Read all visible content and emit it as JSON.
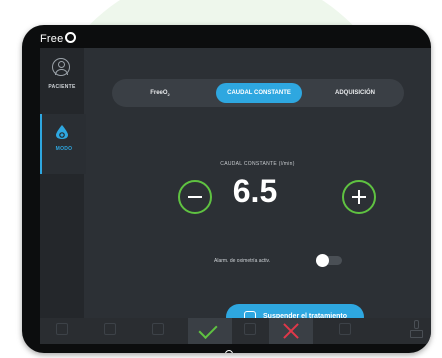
{
  "brand": {
    "name": "Free"
  },
  "sidebar": {
    "items": [
      {
        "label": "PACIENTE",
        "icon": "patient-icon"
      },
      {
        "label": "MODO",
        "icon": "drop-icon"
      }
    ]
  },
  "tabs": [
    {
      "label": "FreeO",
      "subscript": "2"
    },
    {
      "label": "CAUDAL CONSTANTE"
    },
    {
      "label": "ADQUISICIÓN"
    }
  ],
  "flow": {
    "label": "CAUDAL CONSTANTE  (l/min)",
    "value": "6.5"
  },
  "alarm": {
    "label": "Alarm. de oximetría activ."
  },
  "actions": {
    "suspend_label": "Suspender el tratamiento"
  },
  "colors": {
    "accent": "#2ea7e0",
    "confirm": "#5fc241",
    "cancel": "#e0384a",
    "screen_bg": "#2c3035"
  }
}
